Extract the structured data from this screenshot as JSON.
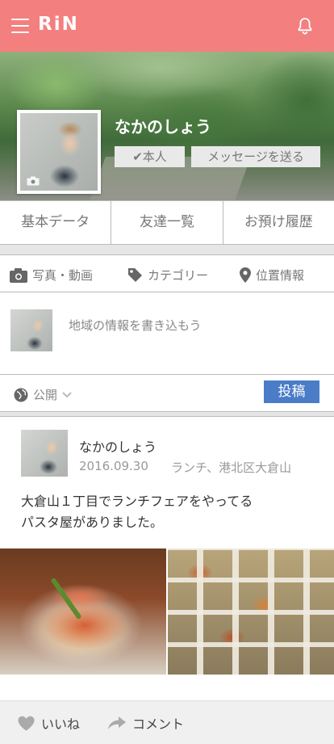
{
  "header": {
    "logo": "RiN",
    "brand_color": "#f47f7f"
  },
  "profile": {
    "name": "なかのしょう",
    "self_button": "✔本人",
    "message_button": "メッセージを送る"
  },
  "tabs": [
    {
      "label": "基本データ"
    },
    {
      "label": "友達一覧"
    },
    {
      "label": "お預け履歴"
    }
  ],
  "composer": {
    "attachments": [
      {
        "label": "写真・動画",
        "icon": "camera-icon"
      },
      {
        "label": "カテゴリー",
        "icon": "tag-icon"
      },
      {
        "label": "位置情報",
        "icon": "location-pin-icon"
      }
    ],
    "placeholder": "地域の情報を書き込もう",
    "visibility": "公開",
    "post_button": "投稿",
    "post_button_color": "#4a7cc7"
  },
  "post": {
    "author": "なかのしょう",
    "date": "2016.09.30",
    "meta": "ランチ、港北区大倉山",
    "body": "大倉山１丁目でランチフェアをやってる\nパスタ屋がありました。"
  },
  "actions": {
    "like": "いいね",
    "comment": "コメント"
  }
}
